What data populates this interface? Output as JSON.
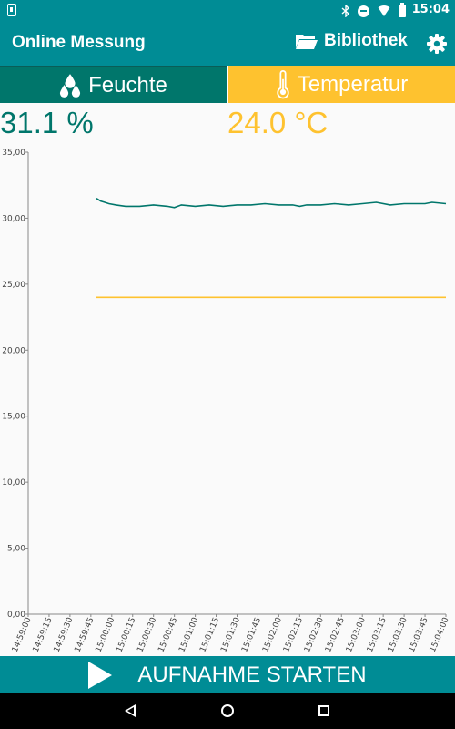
{
  "status_bar": {
    "time": "15:04",
    "icons": [
      "bluetooth-icon",
      "do-not-disturb-icon",
      "wifi-icon",
      "battery-icon"
    ]
  },
  "app_bar": {
    "title": "Online Messung",
    "library_label": "Bibliothek"
  },
  "tabs": [
    {
      "label": "Feuchte",
      "icon": "water-drops-icon",
      "color": "#00766b",
      "selected": true
    },
    {
      "label": "Temperatur",
      "icon": "thermometer-icon",
      "color": "#fec22f",
      "selected": false
    }
  ],
  "readings": {
    "humidity": "31.1 %",
    "temperature": "24.0 °C"
  },
  "action_button": {
    "label": "AUFNAHME STARTEN"
  },
  "colors": {
    "primary": "#008c95",
    "humidity": "#00766b",
    "temperature": "#fec22f"
  },
  "chart_data": {
    "type": "line",
    "title": "",
    "xlabel": "",
    "ylabel": "",
    "ylim": [
      0,
      35
    ],
    "yticks": [
      "0,00",
      "5,00",
      "10,00",
      "15,00",
      "20,00",
      "25,00",
      "30,00",
      "35,00"
    ],
    "x_ticks": [
      "14:59:00",
      "14:59:15",
      "14:59:30",
      "14:59:45",
      "15:00:00",
      "15:00:15",
      "15:00:30",
      "15:00:45",
      "15:01:00",
      "15:01:15",
      "15:01:30",
      "15:01:45",
      "15:02:00",
      "15:02:15",
      "15:02:30",
      "15:02:45",
      "15:03:00",
      "15:03:15",
      "15:03:30",
      "15:03:45",
      "15:04:00"
    ],
    "grid": false,
    "series": [
      {
        "color": "#00766b",
        "x": [
          "14:59:49",
          "14:59:52",
          "14:59:55",
          "14:59:58",
          "15:00:03",
          "15:00:10",
          "15:00:20",
          "15:00:30",
          "15:00:40",
          "15:00:45",
          "15:00:50",
          "15:01:00",
          "15:01:10",
          "15:01:20",
          "15:01:30",
          "15:01:40",
          "15:01:50",
          "15:02:00",
          "15:02:10",
          "15:02:15",
          "15:02:20",
          "15:02:30",
          "15:02:40",
          "15:02:50",
          "15:03:00",
          "15:03:10",
          "15:03:20",
          "15:03:30",
          "15:03:40",
          "15:03:45",
          "15:03:50",
          "15:04:00"
        ],
        "values": [
          31.5,
          31.3,
          31.2,
          31.1,
          31.0,
          30.9,
          30.9,
          31.0,
          30.9,
          30.8,
          31.0,
          30.9,
          31.0,
          30.9,
          31.0,
          31.0,
          31.1,
          31.0,
          31.0,
          30.9,
          31.0,
          31.0,
          31.1,
          31.0,
          31.1,
          31.2,
          31.0,
          31.1,
          31.1,
          31.1,
          31.2,
          31.1
        ]
      },
      {
        "color": "#fec22f",
        "x": [
          "14:59:49",
          "15:04:00"
        ],
        "values": [
          24.0,
          24.0
        ]
      }
    ]
  }
}
